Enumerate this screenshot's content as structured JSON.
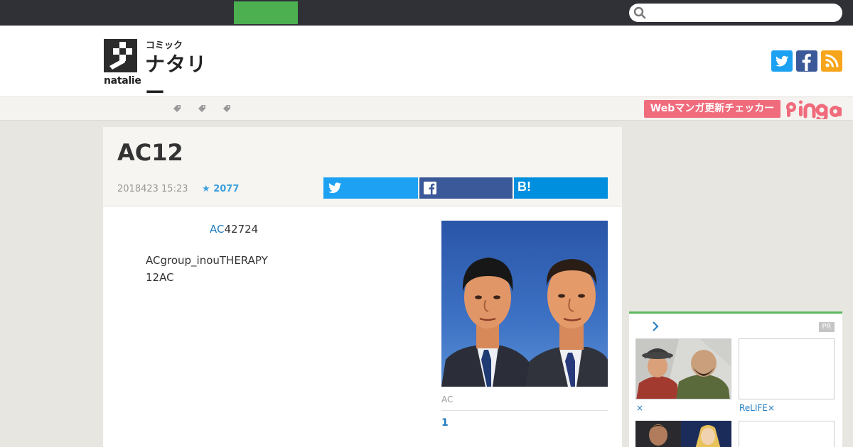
{
  "search": {
    "placeholder": ""
  },
  "brand": {
    "sub": "コミック",
    "main": "ナタリー",
    "wordmark": "natalie"
  },
  "social_icons": [
    "twitter-icon",
    "facebook-icon",
    "rss-icon"
  ],
  "banner": {
    "webmanga_label": "Webマンガ更新チェッカー"
  },
  "article": {
    "title": "AC12",
    "date": "2018423 15:23",
    "star_count": "2077",
    "share_hatena": "B!",
    "link_text": "AC",
    "line1_rest": "42724",
    "line2": "ACgroup_inouTHERAPY",
    "line3": "12AC",
    "caption": "AC",
    "page": "1"
  },
  "sidebar": {
    "pr": "PR",
    "items": [
      {
        "caption": "×"
      },
      {
        "caption": "ReLIFE×"
      }
    ]
  },
  "colors": {
    "topbar": "#2f3136",
    "accent_green": "#4caf50",
    "twitter": "#1da1f2",
    "facebook": "#3b5998",
    "hatena": "#008fde",
    "rss": "#f7a51b",
    "pink": "#f06b7c",
    "link": "#1f7bc1"
  }
}
